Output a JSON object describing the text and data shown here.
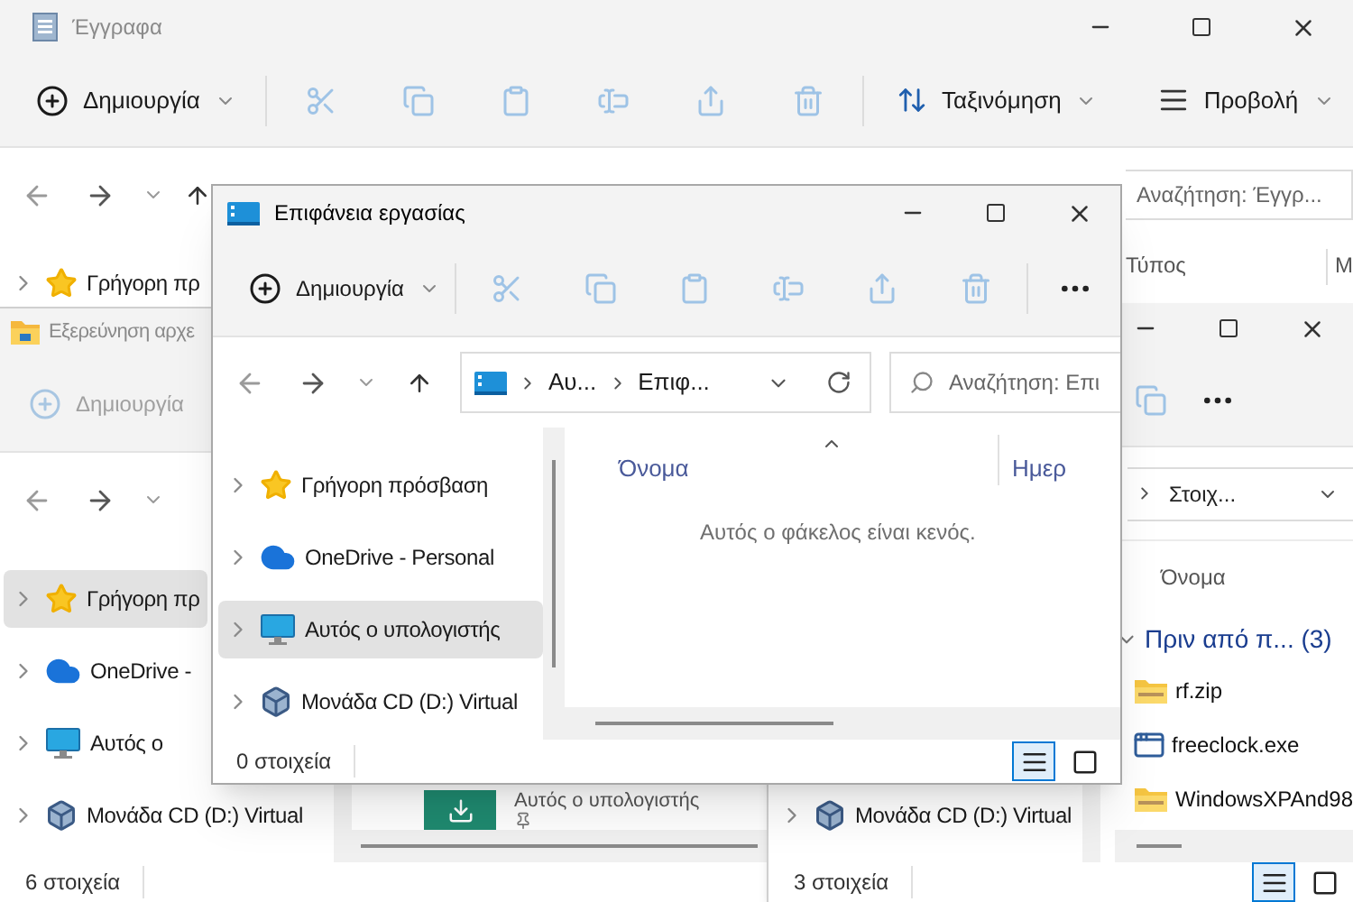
{
  "documents_window": {
    "title": "Έγγραφα",
    "active": false,
    "toolbar": {
      "new": {
        "label": "Δημιουργία",
        "disabled": false
      },
      "sort_label": "Ταξινόμηση",
      "view_label": "Προβολή"
    },
    "search": {
      "placeholder": "Αναζήτηση: Έγγρ..."
    },
    "columns": [
      "Τύπος",
      "M"
    ],
    "nav_tree": [
      {
        "label": "Γρήγορη πρ",
        "kind": "star",
        "selected": false
      }
    ]
  },
  "explorer_window": {
    "title": "Εξερεύνηση αρχε",
    "active": false,
    "toolbar": {
      "new": {
        "label": "Δημιουργία",
        "disabled": true
      }
    },
    "nav_tree": [
      {
        "label": "Γρήγορη πρ",
        "kind": "star",
        "selected": true
      },
      {
        "label": "OneDrive -",
        "kind": "cloud",
        "selected": false
      },
      {
        "label": "Αυτός ο",
        "kind": "pc",
        "selected": false
      },
      {
        "label": "Μονάδα CD (D:) Virtual",
        "kind": "cd",
        "selected": false
      }
    ],
    "tile": {
      "label": "Αυτός ο υπολογιστής"
    },
    "status": "6 στοιχεία"
  },
  "items_window": {
    "address": [
      "Στοιχ..."
    ],
    "columns": [
      "Όνομα"
    ],
    "group": {
      "label": "Πριν από π... (3)",
      "expanded": true
    },
    "files": [
      {
        "name": "rf.zip",
        "kind": "zip"
      },
      {
        "name": "freeclock.exe",
        "kind": "exe"
      },
      {
        "name": "WindowsXPAnd98",
        "kind": "zip"
      }
    ],
    "nav_tree": [
      {
        "label": "Μονάδα CD (D:) Virtual",
        "kind": "cd",
        "selected": false
      }
    ],
    "status": "3 στοιχεία",
    "views": [
      {
        "kind": "details",
        "selected": true
      },
      {
        "kind": "tiles",
        "selected": false
      }
    ]
  },
  "desktop_window": {
    "title": "Επιφάνεια εργασίας",
    "active": true,
    "toolbar": {
      "new": {
        "label": "Δημιουργία",
        "disabled": false
      }
    },
    "address": [
      "Αυ...",
      "Επιφ..."
    ],
    "search": {
      "placeholder": "Αναζήτηση: Επι"
    },
    "nav_tree": [
      {
        "label": "Γρήγορη πρόσβαση",
        "kind": "star",
        "selected": false
      },
      {
        "label": "OneDrive - Personal",
        "kind": "cloud",
        "selected": false
      },
      {
        "label": "Αυτός ο υπολογιστής",
        "kind": "pc",
        "selected": true
      },
      {
        "label": "Μονάδα CD (D:) Virtual",
        "kind": "cd",
        "selected": false
      }
    ],
    "columns": [
      {
        "label": "Όνομα",
        "sorted": true
      },
      {
        "label": "Ημερ",
        "sorted": false
      }
    ],
    "empty_message": "Αυτός ο φάκελος είναι κενός.",
    "status": "0 στοιχεία",
    "views": [
      {
        "kind": "details",
        "selected": true
      },
      {
        "kind": "tiles",
        "selected": false
      }
    ]
  }
}
